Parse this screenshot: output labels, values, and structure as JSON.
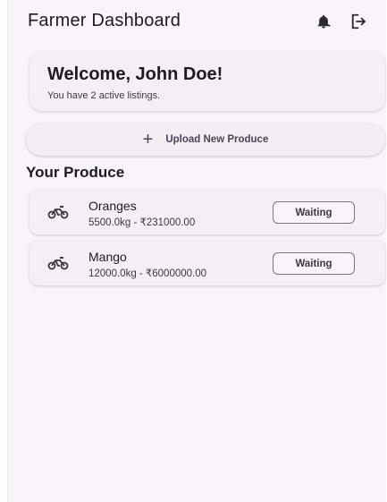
{
  "appbar": {
    "title": "Farmer Dashboard",
    "actions": [
      {
        "icon": "bell-icon"
      },
      {
        "icon": "logout-icon"
      }
    ]
  },
  "welcome": {
    "title": "Welcome, John Doe!",
    "subtitle": "You have 2 active listings."
  },
  "upload": {
    "icon": "plus-icon",
    "label": "Upload New Produce"
  },
  "section_title": "Your Produce",
  "produce": [
    {
      "icon": "bike-icon",
      "name": "Oranges",
      "detail": "5500.0kg - ₹231000.00",
      "status": "Waiting"
    },
    {
      "icon": "bike-icon",
      "name": "Mango",
      "detail": "12000.0kg - ₹6000000.00",
      "status": "Waiting"
    }
  ],
  "colors": {
    "background": "#fbf3fa",
    "card": "#f6eef5",
    "text": "#1d1b20",
    "accent": "#4a4459"
  }
}
